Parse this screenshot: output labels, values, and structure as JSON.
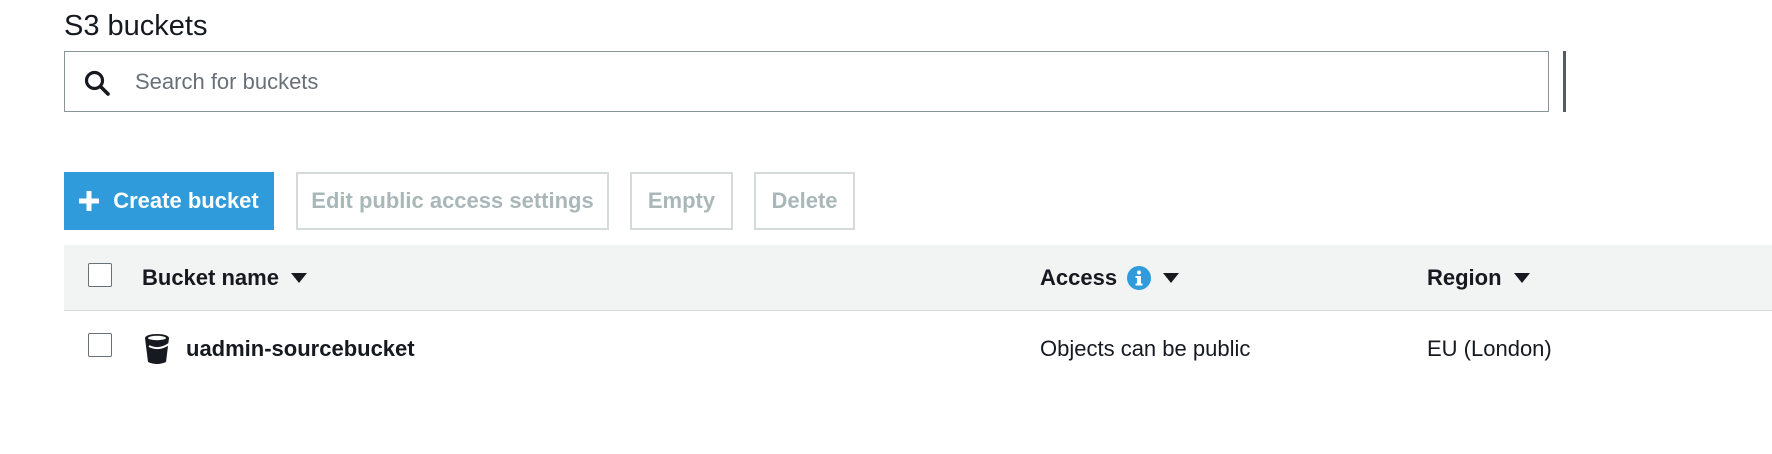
{
  "page": {
    "title": "S3 buckets"
  },
  "search": {
    "placeholder": "Search for buckets",
    "value": ""
  },
  "toolbar": {
    "create_label": "Create bucket",
    "edit_label": "Edit public access settings",
    "empty_label": "Empty",
    "delete_label": "Delete"
  },
  "table": {
    "columns": {
      "name": "Bucket name",
      "access": "Access",
      "region": "Region"
    },
    "rows": [
      {
        "name": "uadmin-sourcebucket",
        "access": "Objects can be public",
        "region": "EU (London)"
      }
    ]
  },
  "colors": {
    "primary": "#2f9bdb",
    "info": "#2f9bdb",
    "disabled_text": "#aab7b8",
    "header_bg": "#f2f3f3"
  },
  "icons": [
    "search-icon",
    "plus-icon",
    "caret-down-icon",
    "info-icon",
    "bucket-icon"
  ]
}
